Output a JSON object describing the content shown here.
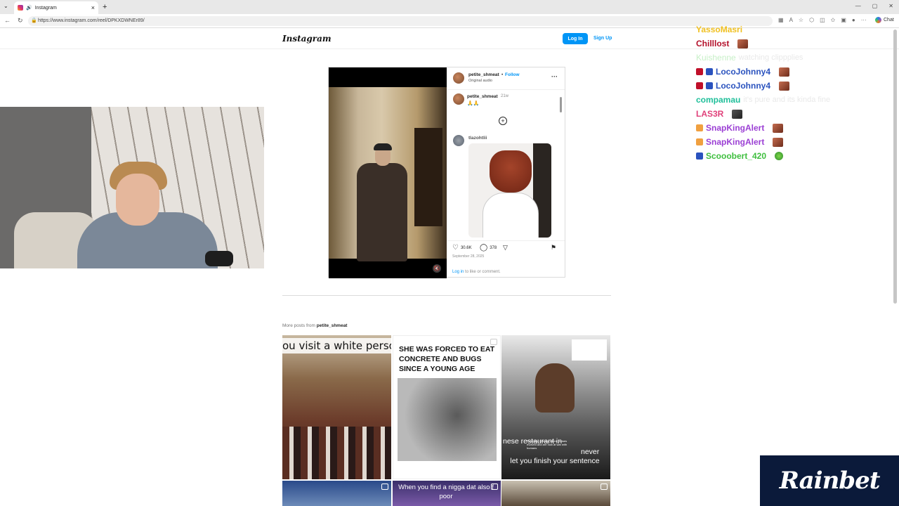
{
  "browser": {
    "tab_title": "Instagram",
    "tab_close": "×",
    "new_tab": "+",
    "url": "https://www.instagram.com/reel/DPKXDWNEr89/",
    "chat_label": "Chat"
  },
  "header": {
    "logo": "Instagram",
    "login_label": "Log In",
    "signup_label": "Sign Up"
  },
  "post": {
    "username": "petite_shmeat",
    "separator": "•",
    "follow_label": "Follow",
    "audio": "Original audio",
    "more": "···",
    "caption": {
      "username": "petite_shmeat",
      "time": "21w",
      "text": "🙏🙏"
    },
    "load_more": "+",
    "comment": {
      "username": "tlazohtlii"
    },
    "likes": "30.6K",
    "comments": "378",
    "date": "September 28, 2025",
    "login_link": "Log in",
    "login_rest": " to like or comment."
  },
  "more_posts": {
    "prefix": "More posts from ",
    "username": "petite_shmeat",
    "tiles": [
      {
        "caption": "ou visit a white person house"
      },
      {
        "caption": "SHE WAS FORCED TO EAT CONCRETE AND BUGS SINCE A YOUNG AGE"
      },
      {
        "caption_top": "nese restaurant in",
        "caption_right": "never",
        "caption_bottom": "let you finish your sentence",
        "small": "Futuristic Chicago where horses evolved and are now at war with humans"
      },
      {
        "caption": ""
      },
      {
        "caption": "When you find a nigga dat also f poor"
      },
      {
        "caption": ""
      }
    ]
  },
  "chat": {
    "messages": [
      {
        "user": "YassoMasri",
        "color": "#f0c020",
        "text": ""
      },
      {
        "user": "Chilllost",
        "color": "#b3102a",
        "text": ""
      },
      {
        "user": "Kuishenne",
        "color": "#c8f0c8",
        "text": "watching clippplies",
        "ghost_user": true
      },
      {
        "user": "LocoJohnny4",
        "color": "#2a52be",
        "text": ""
      },
      {
        "user": "LocoJohnny4",
        "color": "#2a52be",
        "text": ""
      },
      {
        "user": "compamau",
        "color": "#1fbf9a",
        "text": "it's pure and its kinda fine"
      },
      {
        "user": "LAS3R",
        "color": "#e0407a",
        "text": ""
      },
      {
        "user": "SnapKingAlert",
        "color": "#9b3fd4",
        "text": ""
      },
      {
        "user": "SnapKingAlert",
        "color": "#9b3fd4",
        "text": ""
      },
      {
        "user": "Scooobert_420",
        "color": "#3fbf3f",
        "text": ""
      }
    ]
  },
  "sponsor": "Rainbet",
  "colors": {
    "ig_blue": "#0095f6",
    "border": "#dbdbdb"
  }
}
